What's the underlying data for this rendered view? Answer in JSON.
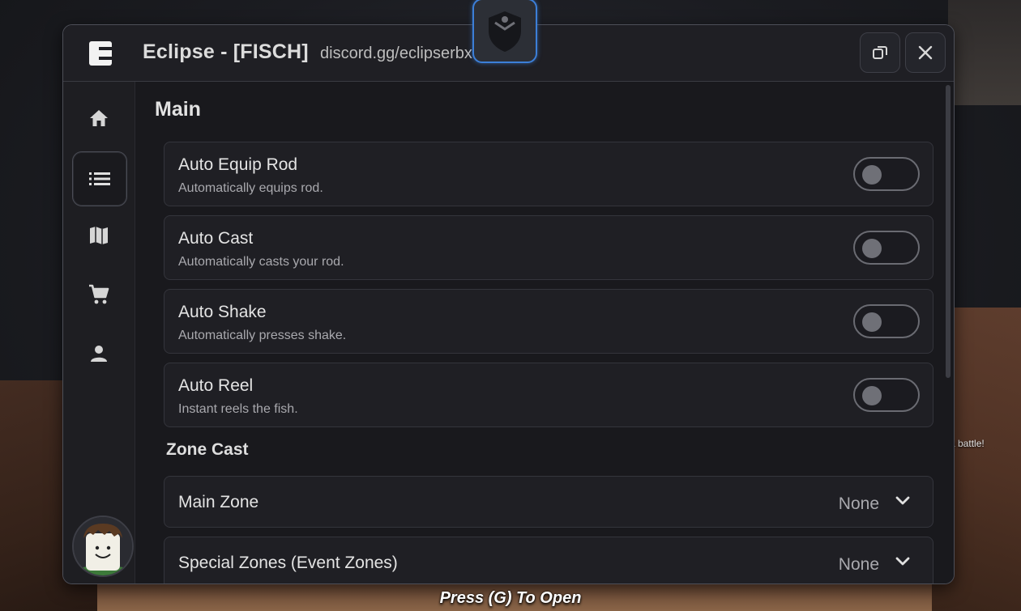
{
  "window": {
    "title": "Eclipse - [FISCH]",
    "subtitle": "discord.gg/eclipserbx"
  },
  "sidebar": {
    "items": [
      {
        "name": "home-icon"
      },
      {
        "name": "list-icon",
        "active": true
      },
      {
        "name": "map-icon"
      },
      {
        "name": "cart-icon"
      },
      {
        "name": "person-icon"
      }
    ]
  },
  "main": {
    "title": "Main",
    "toggles": [
      {
        "title": "Auto Equip Rod",
        "desc": "Automatically equips rod.",
        "on": false
      },
      {
        "title": "Auto Cast",
        "desc": "Automatically casts your rod.",
        "on": false
      },
      {
        "title": "Auto Shake",
        "desc": "Automatically presses shake.",
        "on": false
      },
      {
        "title": "Auto Reel",
        "desc": "Instant reels the fish.",
        "on": false
      }
    ],
    "zone_section_title": "Zone Cast",
    "dropdowns": [
      {
        "title": "Main Zone",
        "value": "None"
      },
      {
        "title": "Special Zones (Event Zones)",
        "value": "None"
      }
    ]
  },
  "overlay": {
    "press_open": "Press (G) To Open",
    "chat_snippet": "a battle!"
  },
  "colors": {
    "window_bg": "#19191d",
    "row_bg": "#1f1f24",
    "accent_badge": "#3c7fd8"
  }
}
